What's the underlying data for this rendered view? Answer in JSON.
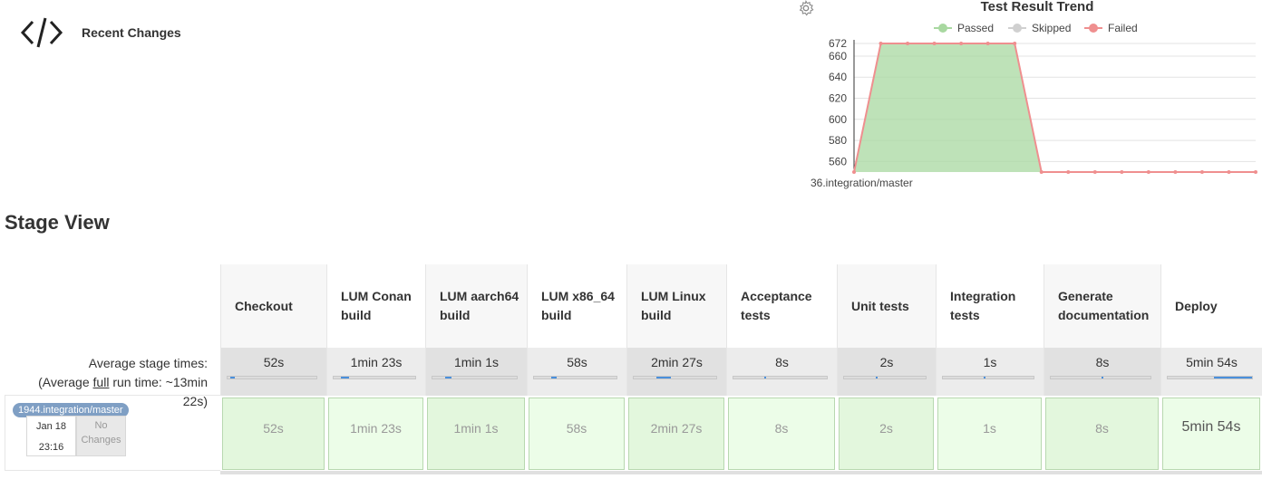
{
  "recent": {
    "label": "Recent Changes",
    "icon": "code-icon"
  },
  "chart_data": {
    "type": "area",
    "title": "Test Result Trend",
    "legend": [
      "Passed",
      "Skipped",
      "Failed"
    ],
    "legend_position": "top",
    "colors": {
      "Passed": "#a8d8a0",
      "Skipped": "#d0d0d0",
      "Failed": "#ef8f8f"
    },
    "yticks": [
      560,
      580,
      600,
      620,
      640,
      660,
      672
    ],
    "ylim": [
      550,
      672
    ],
    "x_label_visible": "36.integration/master",
    "series": [
      {
        "name": "Passed",
        "values": [
          550,
          672,
          672,
          672,
          672,
          672,
          672,
          550,
          550,
          550,
          550,
          550,
          550,
          550,
          550,
          550
        ]
      },
      {
        "name": "Failed",
        "values": [
          550,
          672,
          672,
          672,
          672,
          672,
          672,
          550,
          550,
          550,
          550,
          550,
          550,
          550,
          550,
          550
        ]
      }
    ],
    "grid": true
  },
  "stage_view": {
    "title": "Stage View",
    "avg_label": "Average stage times:",
    "avg_full_prefix": "(Average ",
    "avg_full_word": "full",
    "avg_full_suffix": " run time: ~13min",
    "avg_full_tail": "22s)",
    "stages": [
      {
        "name": "Checkout",
        "avg": "52s",
        "cell": "52s",
        "bar": 0.05
      },
      {
        "name": "LUM Conan build",
        "avg": "1min 23s",
        "cell": "1min 23s",
        "bar": 0.1
      },
      {
        "name": "LUM aarch64 build",
        "avg": "1min 1s",
        "cell": "1min 1s",
        "bar": 0.08
      },
      {
        "name": "LUM x86_64 build",
        "avg": "58s",
        "cell": "58s",
        "bar": 0.07
      },
      {
        "name": "LUM Linux build",
        "avg": "2min 27s",
        "cell": "2min 27s",
        "bar": 0.18
      },
      {
        "name": "Acceptance tests",
        "avg": "8s",
        "cell": "8s",
        "bar": 0.01
      },
      {
        "name": "Unit tests",
        "avg": "2s",
        "cell": "2s",
        "bar": 0.01
      },
      {
        "name": "Integration tests",
        "avg": "1s",
        "cell": "1s",
        "bar": 0.01
      },
      {
        "name": "Generate documentation",
        "avg": "8s",
        "cell": "8s",
        "bar": 0.01
      },
      {
        "name": "Deploy",
        "avg": "5min 54s",
        "cell": "5min 54s",
        "bar": 0.45
      }
    ],
    "build": {
      "name": "1944.integration/master",
      "date": "Jan 18",
      "time": "23:16",
      "changes": "No Changes"
    }
  }
}
